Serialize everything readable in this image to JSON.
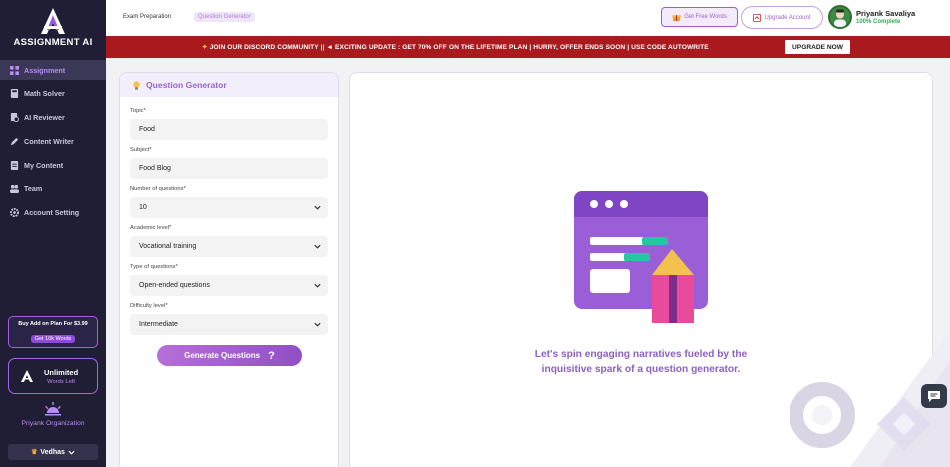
{
  "brand": {
    "name": "ASSIGNMENT AI"
  },
  "sidebar": {
    "items": [
      {
        "label": "Assignment",
        "icon": "grid-icon",
        "active": true
      },
      {
        "label": "Math Solver",
        "icon": "calculator-icon",
        "active": false
      },
      {
        "label": "AI Reviewer",
        "icon": "review-icon",
        "active": false
      },
      {
        "label": "Content Writer",
        "icon": "pen-icon",
        "active": false
      },
      {
        "label": "My Content",
        "icon": "document-icon",
        "active": false
      },
      {
        "label": "Team",
        "icon": "team-icon",
        "active": false
      },
      {
        "label": "Account Setting",
        "icon": "gear-icon",
        "active": false
      }
    ],
    "addon": {
      "title": "Buy Add on Plan For $3.99",
      "button": "Get 10k Words"
    },
    "unlimited": {
      "title": "Unlimited",
      "subtitle": "Words Left"
    },
    "organization": "Priyank Organization",
    "workspace": "Vedhas"
  },
  "header": {
    "breadcrumb": [
      "Exam Preparation",
      "Question Generator"
    ],
    "free_words": "Get Free Words",
    "upgrade": "Upgrade Account",
    "user": {
      "name": "Priyank Savaliya",
      "status": "100% Complete"
    }
  },
  "banner": {
    "text": "JOIN OUR DISCORD COMMUNITY || ◄ EXCITING UPDATE : GET 70% OFF ON THE LIFETIME PLAN | HURRY, OFFER ENDS SOON | USE CODE AUTOWRITE",
    "button": "UPGRADE NOW"
  },
  "form": {
    "title": "Question Generator",
    "fields": [
      {
        "label": "Topic*",
        "value": "Food",
        "type": "text"
      },
      {
        "label": "Subject*",
        "value": "Food Blog",
        "type": "text"
      },
      {
        "label": "Number of questions*",
        "value": "10",
        "type": "select"
      },
      {
        "label": "Academic level*",
        "value": "Vocational training",
        "type": "select"
      },
      {
        "label": "Type of questions*",
        "value": "Open-ended questions",
        "type": "select"
      },
      {
        "label": "Difficulty level*",
        "value": "Intermediate",
        "type": "select"
      }
    ],
    "submit": "Generate Questions",
    "submit_icon": "?"
  },
  "result": {
    "message": "Let's spin engaging narratives fueled by the inquisitive spark of a question generator."
  },
  "colors": {
    "accent": "#9a66c9",
    "sidebar_bg": "#1f1e34",
    "banner_bg": "#a81a1e",
    "status_green": "#2eaf50"
  }
}
